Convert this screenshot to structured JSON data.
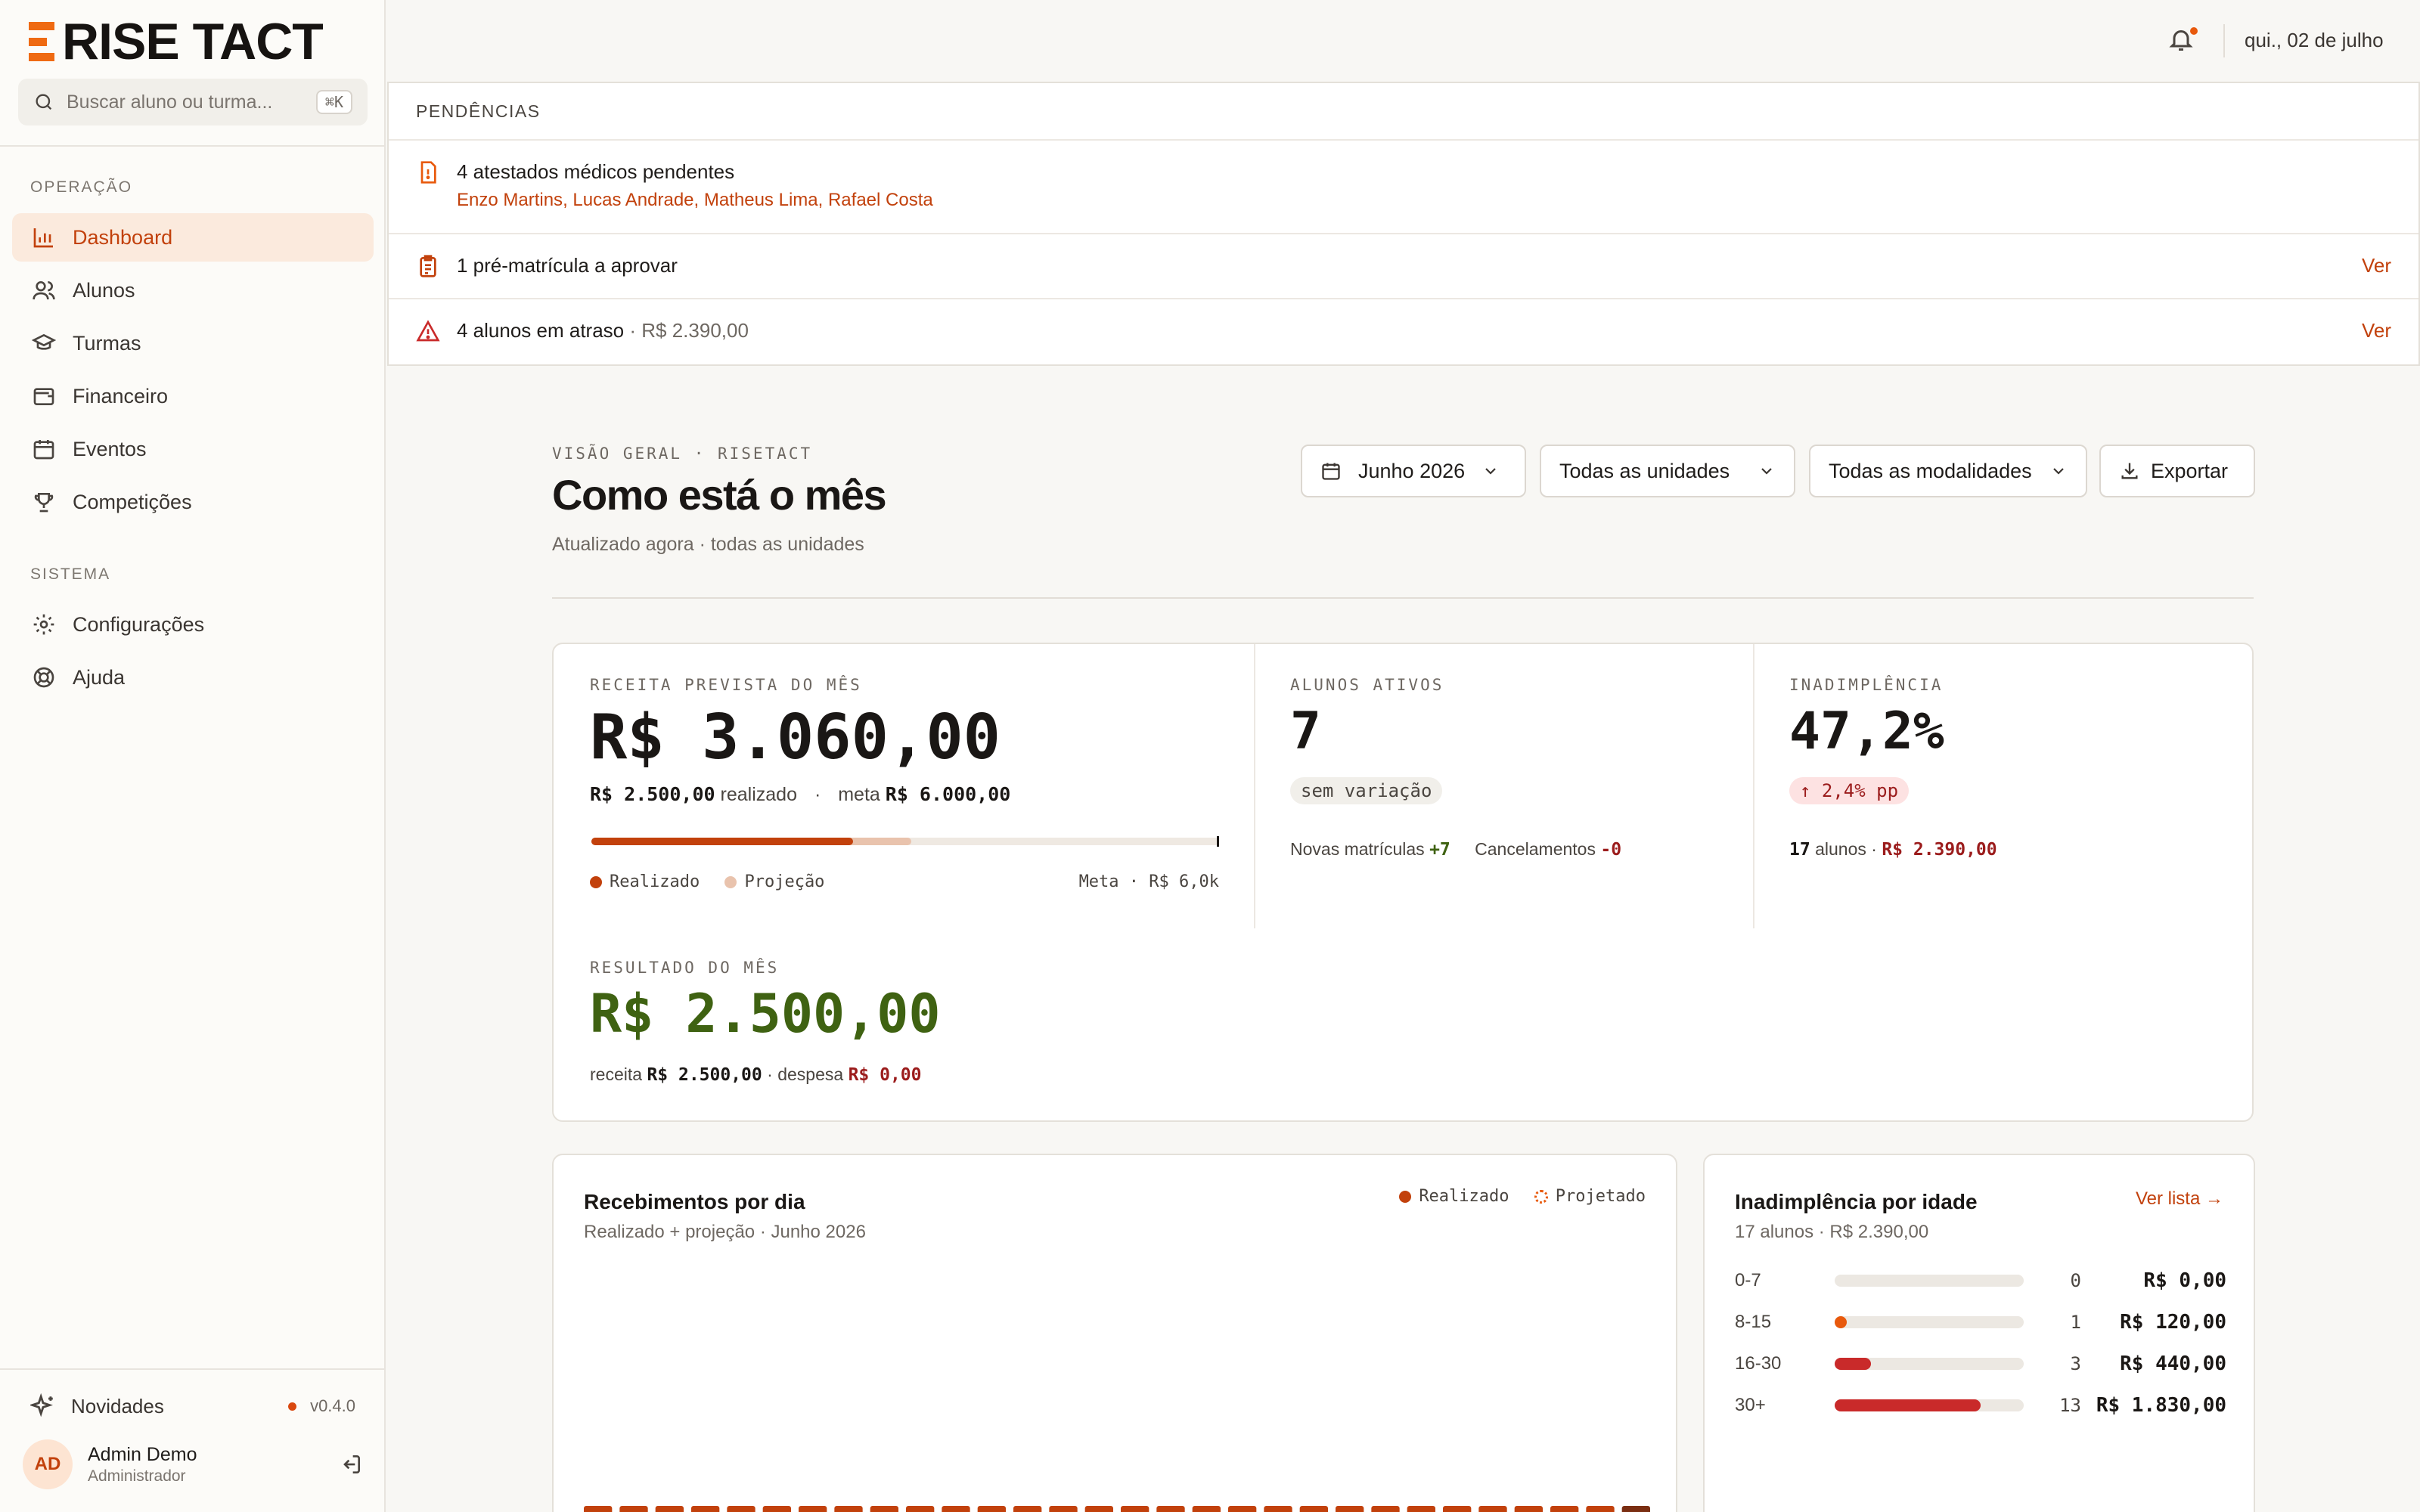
{
  "brand": {
    "name": "RISE TACT"
  },
  "search": {
    "placeholder": "Buscar aluno ou turma...",
    "shortcut": "⌘K"
  },
  "sidebar": {
    "sections": [
      {
        "label": "OPERAÇÃO",
        "items": [
          {
            "label": "Dashboard",
            "icon": "bar-chart-icon",
            "active": true
          },
          {
            "label": "Alunos",
            "icon": "users-icon"
          },
          {
            "label": "Turmas",
            "icon": "graduation-cap-icon"
          },
          {
            "label": "Financeiro",
            "icon": "wallet-icon"
          },
          {
            "label": "Eventos",
            "icon": "calendar-icon"
          },
          {
            "label": "Competições",
            "icon": "trophy-icon"
          }
        ]
      },
      {
        "label": "SISTEMA",
        "items": [
          {
            "label": "Configurações",
            "icon": "gear-icon"
          },
          {
            "label": "Ajuda",
            "icon": "lifebuoy-icon"
          }
        ]
      }
    ],
    "news": {
      "label": "Novidades",
      "version": "v0.4.0"
    },
    "user": {
      "initials": "AD",
      "name": "Admin Demo",
      "role": "Administrador"
    }
  },
  "topbar": {
    "date": "qui., 02 de julho"
  },
  "pendencias": {
    "title": "PENDÊNCIAS",
    "items": [
      {
        "title": "4 atestados médicos pendentes",
        "names": [
          "Enzo Martins",
          "Lucas Andrade",
          "Matheus Lima",
          "Rafael Costa"
        ],
        "icon": "file-alert-icon"
      },
      {
        "title": "1 pré-matrícula a aprovar",
        "action": "Ver",
        "icon": "clipboard-icon"
      },
      {
        "title": "4 alunos em atraso",
        "detail": "· R$ 2.390,00",
        "action": "Ver",
        "icon": "warning-triangle-icon"
      }
    ]
  },
  "header": {
    "eyebrow": "VISÃO GERAL · RISETACT",
    "title": "Como está o mês",
    "subtitle": "Atualizado agora · todas as unidades",
    "filters": {
      "month": "Junho 2026",
      "unit": "Todas as unidades",
      "modality": "Todas as modalidades",
      "export": "Exportar"
    }
  },
  "kpis": {
    "revenue": {
      "label": "RECEITA PREVISTA DO MÊS",
      "value": "R$ 3.060,00",
      "realized_value": "R$ 2.500,00",
      "realized_word": "realizado",
      "separator": "·",
      "goal_word": "meta",
      "goal_value": "R$ 6.000,00",
      "realized_fraction": 0.4167,
      "projected_fraction": 0.51,
      "legend_realized": "Realizado",
      "legend_projection": "Projeção",
      "goal_short": "Meta · R$ 6,0k"
    },
    "students": {
      "label": "ALUNOS ATIVOS",
      "value": "7",
      "badge": "sem variação",
      "new_label": "Novas matrículas",
      "new_value": "+7",
      "cancel_label": "Cancelamentos",
      "cancel_value": "-0"
    },
    "default": {
      "label": "INADIMPLÊNCIA",
      "value": "47,2%",
      "badge": "↑ 2,4% pp",
      "count": "17",
      "count_word": "alunos ·",
      "amount": "R$ 2.390,00"
    },
    "result": {
      "label": "RESULTADO DO MÊS",
      "value": "R$ 2.500,00",
      "revenue_word": "receita",
      "revenue_value": "R$ 2.500,00",
      "expense_word": "· despesa",
      "expense_value": "R$ 0,00"
    }
  },
  "daily_chart": {
    "title": "Recebimentos por dia",
    "subtitle": "Realizado + projeção · Junho 2026",
    "legend_realized": "Realizado",
    "legend_projected": "Projetado"
  },
  "aging": {
    "title": "Inadimplência por idade",
    "subtitle": "17 alunos · R$ 2.390,00",
    "link": "Ver lista →",
    "rows": [
      {
        "range": "0-7",
        "count": "0",
        "amount": "R$ 0,00",
        "fraction": 0,
        "color": "#e8590c"
      },
      {
        "range": "8-15",
        "count": "1",
        "amount": "R$ 120,00",
        "fraction": 0.06,
        "color": "#e8590c"
      },
      {
        "range": "16-30",
        "count": "3",
        "amount": "R$ 440,00",
        "fraction": 0.19,
        "color": "#c92a2a"
      },
      {
        "range": "30+",
        "count": "13",
        "amount": "R$ 1.830,00",
        "fraction": 0.77,
        "color": "#c92a2a"
      }
    ]
  },
  "colors": {
    "accent": "#c2410c",
    "accent_soft": "#fbeadd",
    "brand_orange": "#ef6a12",
    "positive": "#3f6212",
    "negative": "#9b1c1c"
  }
}
